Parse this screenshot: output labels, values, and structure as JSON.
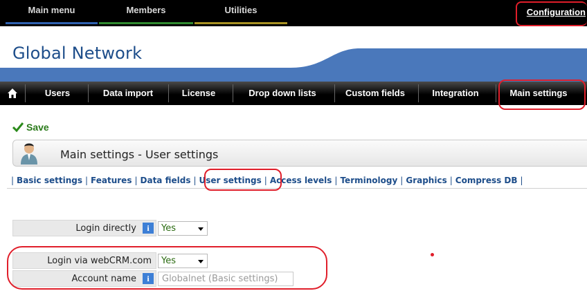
{
  "top_menu": {
    "items": [
      "Main menu",
      "Members",
      "Utilities"
    ],
    "configuration": "Configuration"
  },
  "brand": {
    "title": "Global Network"
  },
  "nav": {
    "items": [
      "Users",
      "Data import",
      "License",
      "Drop down lists",
      "Custom fields",
      "Integration",
      "Main settings"
    ]
  },
  "toolbar": {
    "save_label": "Save"
  },
  "panel": {
    "title": "Main settings - User settings"
  },
  "tabs": [
    "Basic settings",
    "Features",
    "Data fields",
    "User settings",
    "Access levels",
    "Terminology",
    "Graphics",
    "Compress DB"
  ],
  "form": {
    "login_directly": {
      "label": "Login directly",
      "value": "Yes",
      "info": "i"
    },
    "login_webcrm": {
      "label": "Login via webCRM.com",
      "value": "Yes"
    },
    "account_name": {
      "label": "Account name",
      "value": "Globalnet   (Basic settings)",
      "info": "i"
    }
  },
  "colors": {
    "brand_blue": "#1d4d8a",
    "accent_red": "#e01e2a",
    "save_green": "#2a7a1a"
  }
}
